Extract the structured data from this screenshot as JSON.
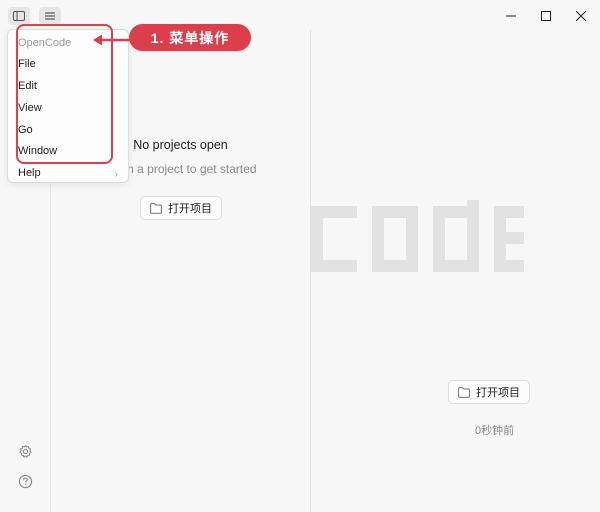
{
  "menu": {
    "items": [
      {
        "label": "OpenCode",
        "dim": true
      },
      {
        "label": "File"
      },
      {
        "label": "Edit"
      },
      {
        "label": "View"
      },
      {
        "label": "Go"
      },
      {
        "label": "Window"
      },
      {
        "label": "Help",
        "has_submenu": true
      }
    ]
  },
  "annotation": {
    "label": "1. 菜单操作",
    "color": "#dd3e4b"
  },
  "center": {
    "title": "No projects open",
    "subtitle": "Open a project to get started",
    "open_button": "打开项目"
  },
  "right": {
    "wordmark": "code",
    "open_button": "打开项目",
    "time_ago": "0秒钟前"
  },
  "icons": {
    "sidebar_toggle": "sidebar-toggle-icon",
    "menu": "hamburger-menu-icon",
    "minimize": "minimize-icon",
    "maximize": "maximize-icon",
    "close": "close-icon",
    "settings": "gear-icon",
    "help": "help-circle-icon",
    "folder": "folder-icon"
  }
}
